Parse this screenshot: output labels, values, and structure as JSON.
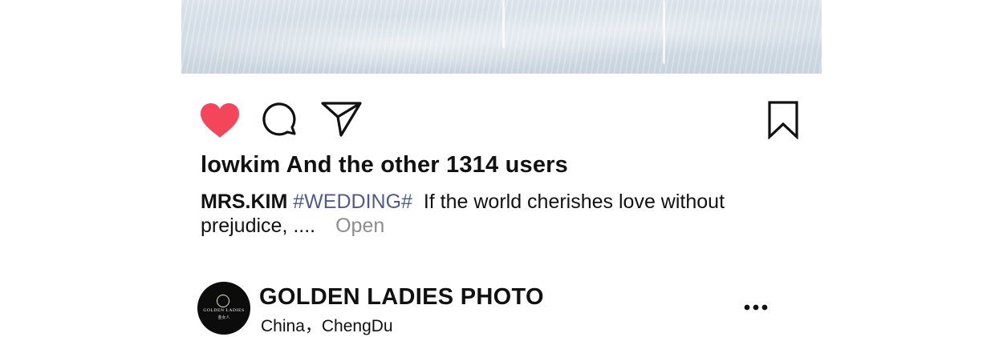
{
  "post": {
    "photo_alt": "wedding-dress-photo",
    "actions": {
      "like_icon": "heart-filled-icon",
      "comment_icon": "comment-bubble-icon",
      "share_icon": "paper-plane-icon",
      "save_icon": "bookmark-icon"
    },
    "likes_text": "lowkim And the other 1314 users",
    "caption": {
      "username": "MRS.KIM",
      "hashtag": "#WEDDING#",
      "text": "If the world cherishes love without prejudice, ....",
      "open_label": "Open"
    }
  },
  "next_post": {
    "avatar_logo_text": "GOLDEN LADIES",
    "avatar_logo_sub": "金女人",
    "account_name": "GOLDEN LADIES PHOTO",
    "location": "China，ChengDu",
    "more_icon": "more-dots-icon"
  },
  "colors": {
    "like": "#f4465a",
    "hashtag": "#4f5b8f",
    "muted": "#8d8d8d"
  }
}
